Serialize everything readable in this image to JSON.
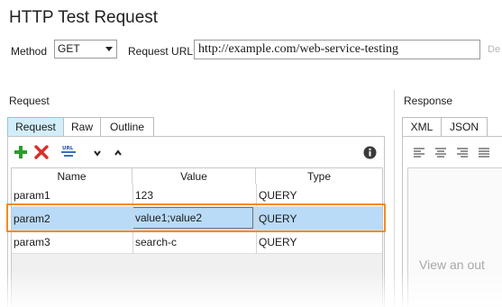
{
  "title": "HTTP Test Request",
  "method": {
    "label": "Method",
    "value": "GET"
  },
  "url": {
    "label": "Request URL:",
    "value": "http://example.com/web-service-testing",
    "cutoff": "De"
  },
  "request": {
    "section_label": "Request",
    "tabs": [
      {
        "label": "Request",
        "active": true
      },
      {
        "label": "Raw"
      },
      {
        "label": "Outline"
      }
    ],
    "toolbar": {
      "add_icon": "plus-icon",
      "delete_icon": "x-icon",
      "url_icon": "url-encode-icon",
      "down_icon": "chevron-down-icon",
      "up_icon": "chevron-up-icon",
      "info_icon": "info-icon"
    },
    "columns": [
      "Name",
      "Value",
      "Type"
    ],
    "rows": [
      {
        "name": "param1",
        "value": "123",
        "type": "QUERY"
      },
      {
        "name": "param2",
        "value": "value1;value2",
        "type": "QUERY",
        "selected": true
      },
      {
        "name": "param3",
        "value": "search-c",
        "type": "QUERY"
      }
    ]
  },
  "response": {
    "section_label": "Response",
    "tabs": [
      {
        "label": "XML",
        "active": true
      },
      {
        "label": "JSON"
      }
    ],
    "placeholder": "View an out"
  },
  "colors": {
    "accent_tab": "#d2eefb",
    "selection": "#b9dbf7",
    "highlight": "#f28c1e",
    "add_green": "#2a9d2a",
    "delete_red": "#d9302a"
  }
}
